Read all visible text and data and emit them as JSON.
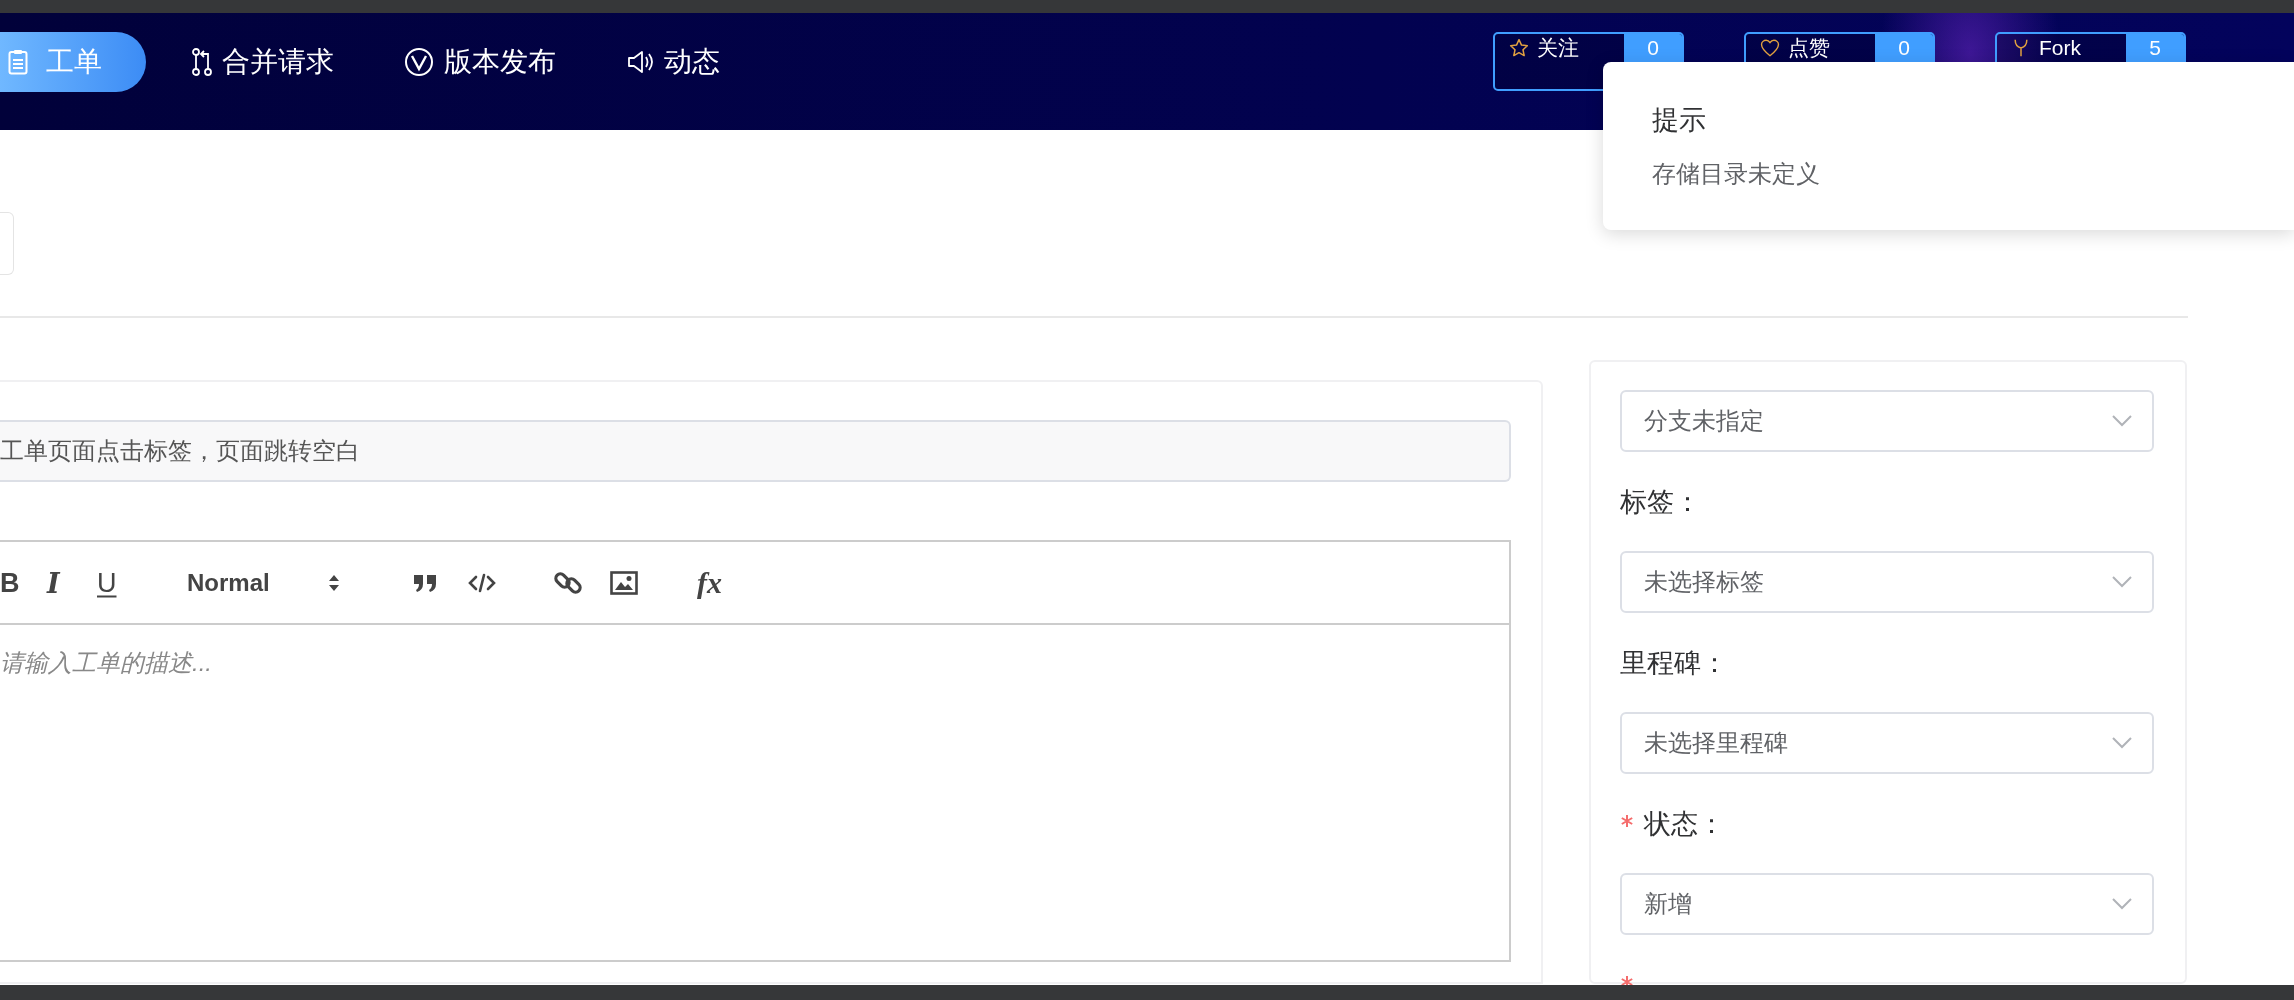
{
  "top_nav": {
    "items": [
      {
        "label": "工单",
        "selected": true
      },
      {
        "label": "合并请求",
        "selected": false
      },
      {
        "label": "版本发布",
        "selected": false
      },
      {
        "label": "动态",
        "selected": false
      }
    ]
  },
  "repo_actions": [
    {
      "label": "关注",
      "count": "0"
    },
    {
      "label": "点赞",
      "count": "0"
    },
    {
      "label": "Fork",
      "count": "5"
    }
  ],
  "issue_form": {
    "title_field": {
      "value": "工单页面点击标签，页面跳转空白"
    },
    "editor": {
      "toolbar": [
        {
          "kind": "bold",
          "text": "B"
        },
        {
          "kind": "italic",
          "text": "I"
        },
        {
          "kind": "underline",
          "text": "U"
        },
        {
          "kind": "picker",
          "text": "Normal"
        },
        {
          "kind": "quote"
        },
        {
          "kind": "code"
        },
        {
          "kind": "link"
        },
        {
          "kind": "image"
        },
        {
          "kind": "formula",
          "text": "fx"
        }
      ],
      "placeholder": "请输入工单的描述..."
    }
  },
  "sidebar": {
    "fields": [
      {
        "required": false,
        "value": "分支未指定"
      },
      {
        "label": "标签：",
        "required": false,
        "value": "未选择标签"
      },
      {
        "label": "里程碑：",
        "required": false,
        "value": "未选择里程碑"
      },
      {
        "label": "状态：",
        "required": true,
        "value": "新增"
      },
      {
        "required": true
      }
    ]
  },
  "notification": {
    "title": "提示",
    "message": "存储目录未定义"
  }
}
